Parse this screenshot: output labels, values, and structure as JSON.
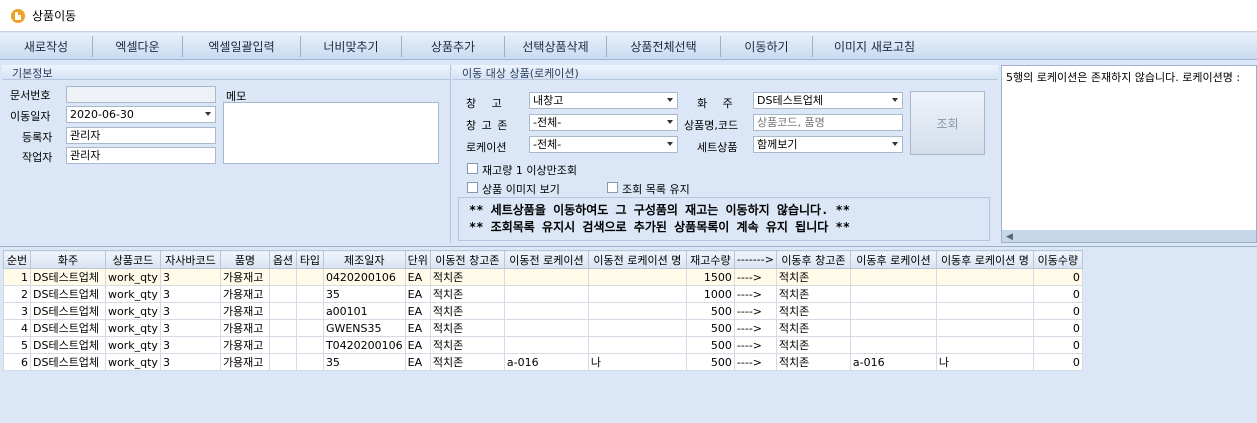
{
  "window": {
    "title": "상품이동"
  },
  "toolbar": [
    "새로작성",
    "엑셀다운",
    "엑셀일괄입력",
    "너비맞추기",
    "상품추가",
    "선택상품삭제",
    "상품전체선택",
    "이동하기",
    "이미지 새로고침"
  ],
  "basic": {
    "section_title": "기본정보",
    "doc_no_label": "문서번호",
    "doc_no_value": "",
    "move_date_label": "이동일자",
    "move_date_value": "2020-06-30",
    "registrant_label": "등록자",
    "registrant_value": "관리자",
    "worker_label": "작업자",
    "worker_value": "관리자",
    "memo_label": "메모",
    "memo_value": ""
  },
  "target": {
    "section_title": "이동 대상 상품(로케이션)",
    "warehouse_label": "창 고",
    "warehouse_value": "내창고",
    "owner_label": "화 주",
    "owner_value": "DS테스트업체",
    "zone_label": "창 고 존",
    "zone_value": "-전체-",
    "product_label": "상품명,코드",
    "product_placeholder": "상품코드, 품명",
    "location_label": "로케이션",
    "location_value": "-전체-",
    "set_label": "세트상품",
    "set_value": "함께보기",
    "query_button": "조회",
    "chk_stock": "재고량 1 이상만조회",
    "chk_image": "상품 이미지 보기",
    "chk_keep": "조회 목록 유지",
    "notice_1": "** 세트상품을 이동하여도 그 구성품의 재고는 이동하지 않습니다. **",
    "notice_2": "** 조회목록 유지시 검색으로 추가된 상품목록이 계속 유지 됩니다 **"
  },
  "message": {
    "text": "5행의 로케이션은 존재하지 않습니다. 로케이션명 :"
  },
  "grid": {
    "columns": [
      "순번",
      "화주",
      "상품코드",
      "자사바코드",
      "품명",
      "옵션",
      "타입",
      "제조일자",
      "단위",
      "이동전 창고존",
      "이동전 로케이션",
      "이동전 로케이션 명",
      "재고수량",
      "------->",
      "이동후 창고존",
      "이동후 로케이션",
      "이동후 로케이션 명",
      "이동수량"
    ],
    "rows": [
      [
        "1",
        "DS테스트업체",
        "work_qty",
        "3",
        "가용재고",
        "",
        "",
        "0420200106",
        "EA",
        "적치존",
        "",
        "",
        "1500",
        "---->",
        "적치존",
        "",
        "",
        "0"
      ],
      [
        "2",
        "DS테스트업체",
        "work_qty",
        "3",
        "가용재고",
        "",
        "",
        "35",
        "EA",
        "적치존",
        "",
        "",
        "1000",
        "---->",
        "적치존",
        "",
        "",
        "0"
      ],
      [
        "3",
        "DS테스트업체",
        "work_qty",
        "3",
        "가용재고",
        "",
        "",
        "a00101",
        "EA",
        "적치존",
        "",
        "",
        "500",
        "---->",
        "적치존",
        "",
        "",
        "0"
      ],
      [
        "4",
        "DS테스트업체",
        "work_qty",
        "3",
        "가용재고",
        "",
        "",
        "GWENS35",
        "EA",
        "적치존",
        "",
        "",
        "500",
        "---->",
        "적치존",
        "",
        "",
        "0"
      ],
      [
        "5",
        "DS테스트업체",
        "work_qty",
        "3",
        "가용재고",
        "",
        "",
        "T0420200106",
        "EA",
        "적치존",
        "",
        "",
        "500",
        "---->",
        "적치존",
        "",
        "",
        "0"
      ],
      [
        "6",
        "DS테스트업체",
        "work_qty",
        "3",
        "가용재고",
        "",
        "",
        "35",
        "EA",
        "적치존",
        "a-016",
        "나",
        "500",
        "---->",
        "적치존",
        "a-016",
        "나",
        "0"
      ]
    ]
  }
}
